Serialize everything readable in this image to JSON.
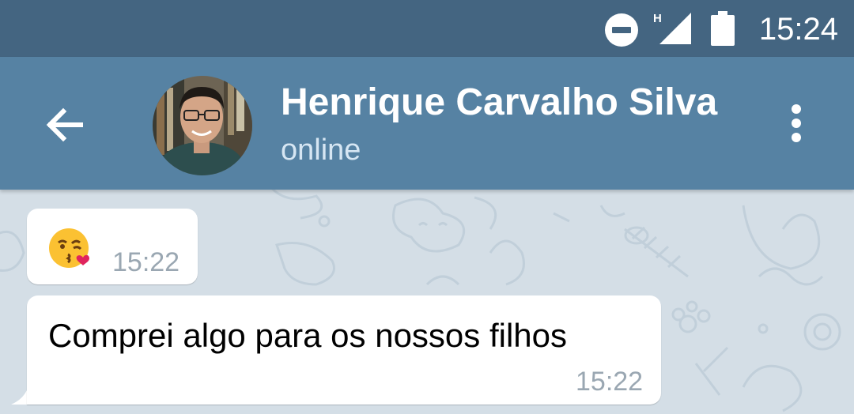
{
  "status_bar": {
    "time": "15:24",
    "network_type": "H",
    "icons": [
      "do-not-disturb-icon",
      "signal-icon",
      "battery-icon"
    ]
  },
  "header": {
    "title": "Henrique Carvalho Silva",
    "subtitle": "online",
    "icons": [
      "back-arrow-icon",
      "avatar",
      "more-vert-icon"
    ]
  },
  "messages": [
    {
      "text": "",
      "emoji": "kissing-face-with-heart-emoji",
      "time": "15:22",
      "direction": "incoming"
    },
    {
      "text": "Comprei algo para os nossos filhos",
      "time": "15:22",
      "direction": "incoming"
    }
  ],
  "colors": {
    "status_bar": "#446581",
    "toolbar": "#5682a3",
    "chat_background": "#d4dee6",
    "bubble": "#ffffff",
    "time_text": "#9aa7b2"
  }
}
